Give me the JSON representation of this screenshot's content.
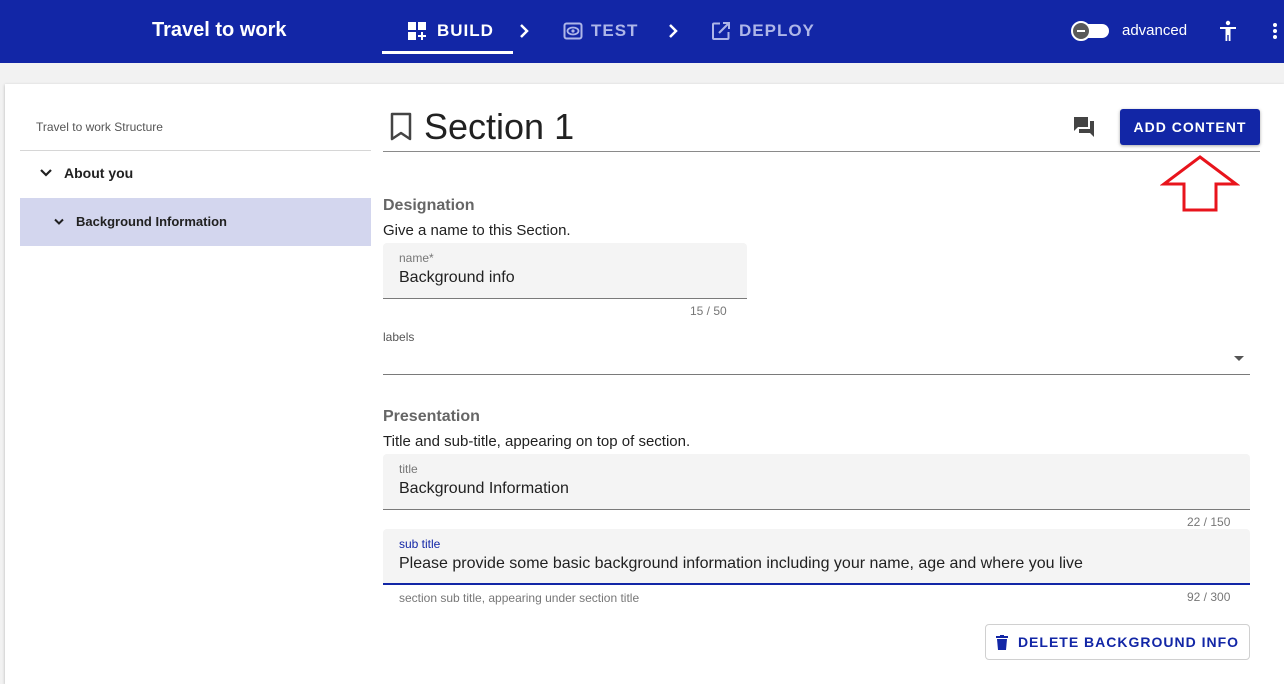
{
  "app": {
    "title": "Travel to work"
  },
  "nav": {
    "tabs": [
      {
        "label": "BUILD",
        "icon": "build-grid-icon",
        "active": true
      },
      {
        "label": "TEST",
        "icon": "eye-icon",
        "active": false
      },
      {
        "label": "DEPLOY",
        "icon": "open-external-icon",
        "active": false
      }
    ],
    "advanced_label": "advanced"
  },
  "sidebar": {
    "heading": "Travel to work Structure",
    "items": [
      {
        "label": "About you",
        "level": 1
      },
      {
        "label": "Background Information",
        "level": 2,
        "selected": true
      }
    ]
  },
  "section": {
    "title": "Section 1",
    "add_content_label": "ADD CONTENT"
  },
  "designation": {
    "heading": "Designation",
    "description": "Give a name to this Section.",
    "name_label": "name*",
    "name_value": "Background info",
    "name_counter": "15 / 50",
    "labels_label": "labels"
  },
  "presentation": {
    "heading": "Presentation",
    "description": "Title and sub-title, appearing on top of section.",
    "title_label": "title",
    "title_value": "Background Information",
    "title_counter": "22 / 150",
    "subtitle_label": "sub title",
    "subtitle_value": "Please provide some basic background information including your name, age and where you live",
    "subtitle_hint": "section sub title, appearing under section title",
    "subtitle_counter": "92 / 300"
  },
  "actions": {
    "delete_label": "DELETE BACKGROUND INFO"
  },
  "colors": {
    "primary": "#1226a6",
    "selected_bg": "#d3d6ee",
    "annotation": "#e8141c"
  }
}
